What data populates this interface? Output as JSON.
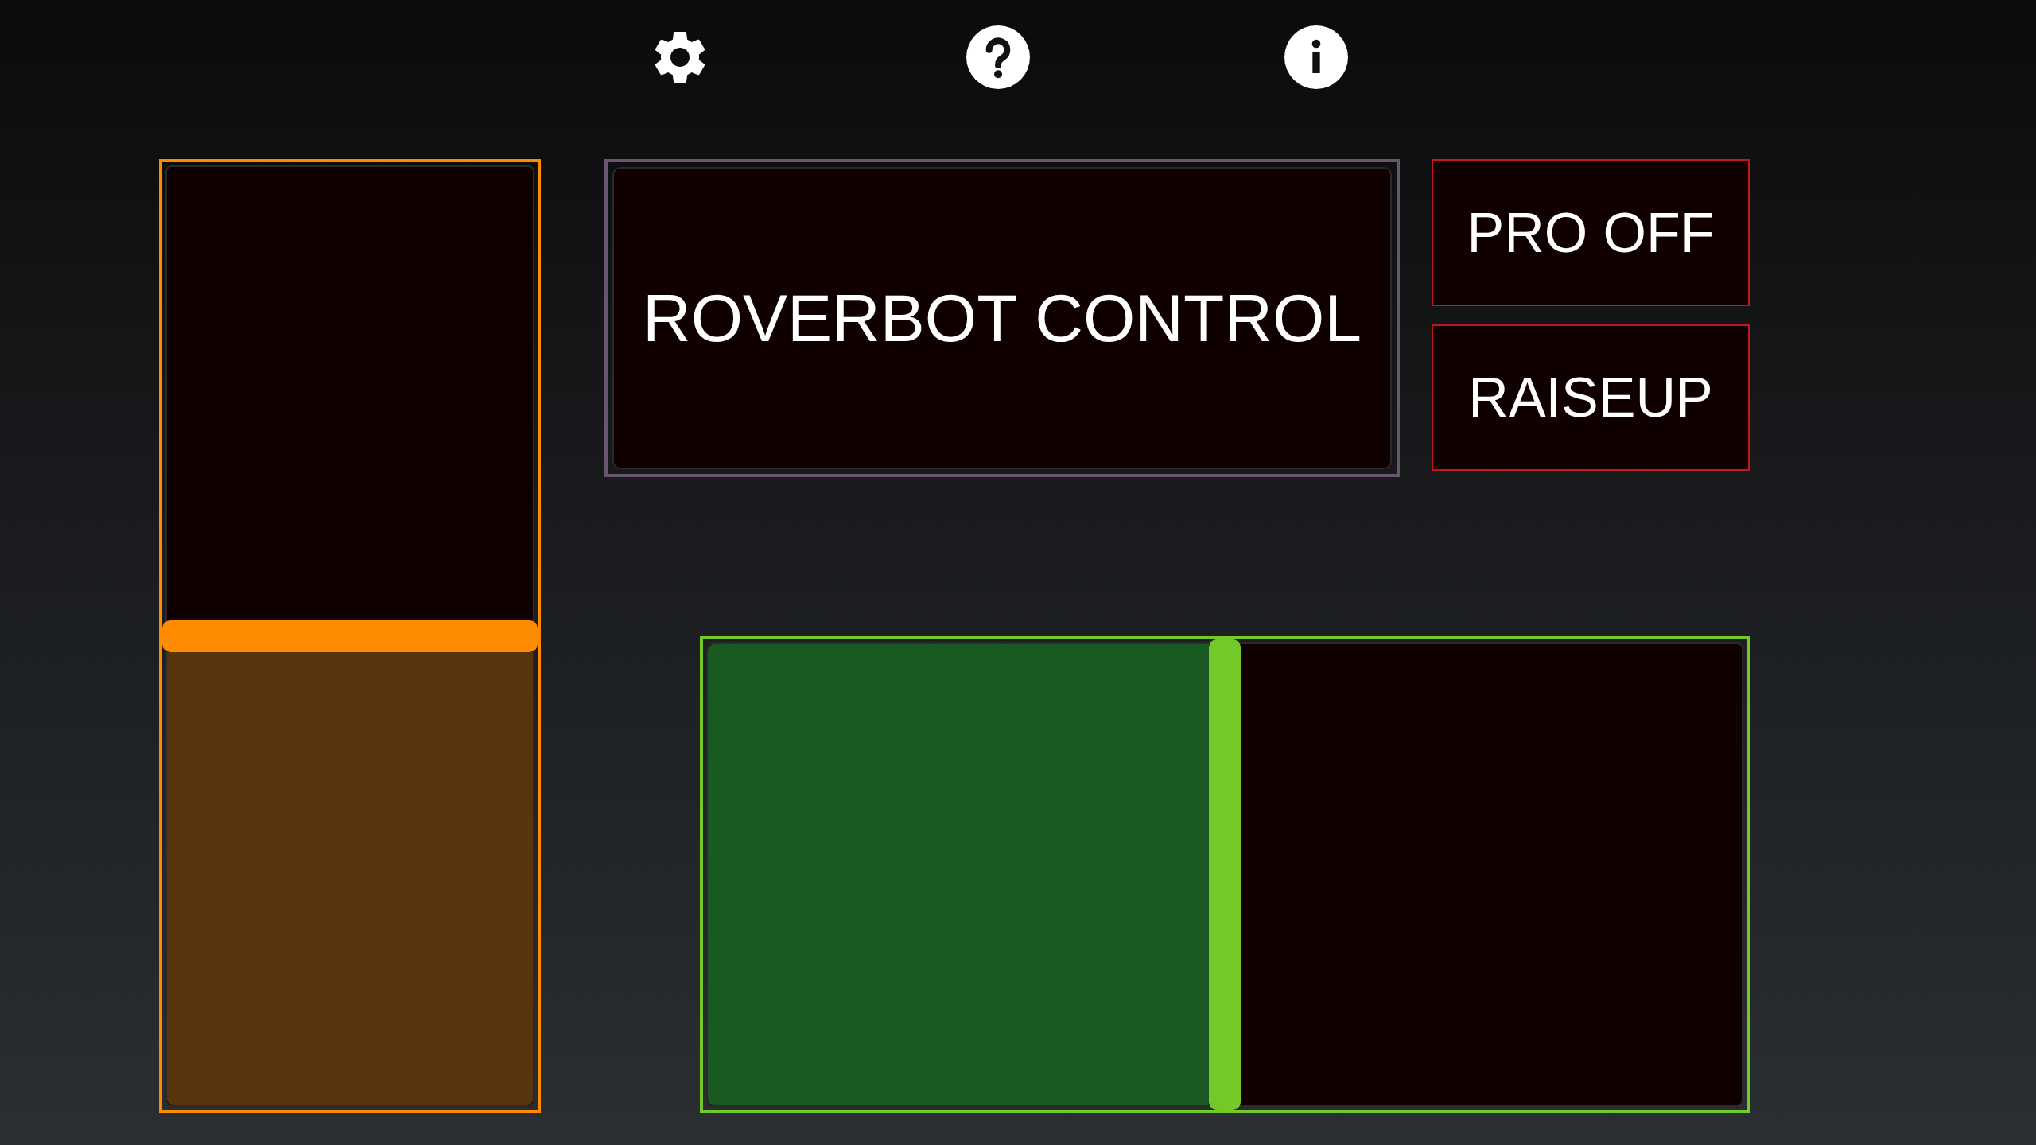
{
  "title": "ROVERBOT CONTROL",
  "buttons": [
    {
      "label": "PRO OFF"
    },
    {
      "label": "RAISEUP"
    }
  ],
  "vertical_slider": {
    "level": 0.5
  },
  "horizontal_slider": {
    "level": 0.5
  }
}
